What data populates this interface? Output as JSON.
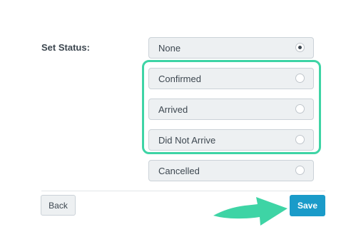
{
  "form": {
    "label": "Set Status:",
    "options": [
      {
        "label": "None",
        "selected": true
      },
      {
        "label": "Confirmed",
        "selected": false
      },
      {
        "label": "Arrived",
        "selected": false
      },
      {
        "label": "Did Not Arrive",
        "selected": false
      },
      {
        "label": "Cancelled",
        "selected": false
      }
    ]
  },
  "actions": {
    "back_label": "Back",
    "save_label": "Save"
  },
  "colors": {
    "highlight": "#3ed4a5",
    "save_button": "#1a9bc9",
    "arrow": "#3ed4a5"
  },
  "icons": {
    "arrow": "curved-arrow-right-icon",
    "radio": "radio-icon"
  }
}
